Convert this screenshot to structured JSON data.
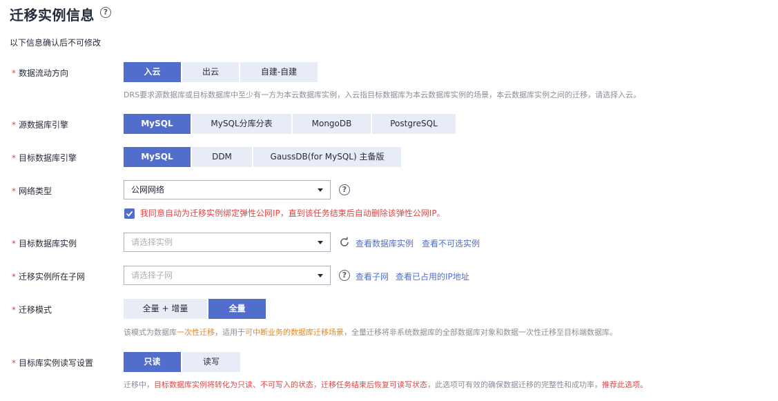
{
  "header": {
    "title": "迁移实例信息",
    "help_glyph": "?",
    "subtitle": "以下信息确认后不可修改"
  },
  "required_mark": "*",
  "direction": {
    "label": "数据流动方向",
    "options": [
      "入云",
      "出云",
      "自建-自建"
    ],
    "selected": "入云",
    "hint": "DRS要求源数据库或目标数据库中至少有一方为本云数据库实例，入云指目标数据库为本云数据库实例的场景，本云数据库实例之间的迁移，请选择入云。"
  },
  "source_engine": {
    "label": "源数据库引擎",
    "options": [
      "MySQL",
      "MySQL分库分表",
      "MongoDB",
      "PostgreSQL"
    ],
    "selected": "MySQL"
  },
  "target_engine": {
    "label": "目标数据库引擎",
    "options": [
      "MySQL",
      "DDM",
      "GaussDB(for MySQL) 主备版"
    ],
    "selected": "MySQL"
  },
  "network": {
    "label": "网络类型",
    "value": "公网网络",
    "help_glyph": "?",
    "checkbox_checked": true,
    "checkbox_text": "我同意自动为迁移实例绑定弹性公网IP，直到该任务结束后自动删除该弹性公网IP。"
  },
  "target_instance": {
    "label": "目标数据库实例",
    "placeholder": "请选择实例",
    "link_view": "查看数据库实例",
    "link_unselectable": "查看不可选实例"
  },
  "subnet": {
    "label": "迁移实例所在子网",
    "placeholder": "请选择子网",
    "help_glyph": "?",
    "link_view": "查看子网",
    "link_ip": "查看已占用的IP地址"
  },
  "mode": {
    "label": "迁移模式",
    "options": [
      "全量 + 增量",
      "全量"
    ],
    "selected": "全量",
    "hint_parts": [
      "该模式为数据库",
      "一次性迁移",
      "，适用于",
      "可中断业务的数据库迁移场景",
      "，全量迁移将非系统数据库的全部数据库对象和数据一次性迁移至目标端数据库。"
    ]
  },
  "readwrite": {
    "label": "目标库实例读写设置",
    "options": [
      "只读",
      "读写"
    ],
    "selected": "只读",
    "hint_parts": [
      "迁移中，",
      "目标数据库实例将转化为只读、不可写入的状态",
      "，",
      "迁移任务结束后恢复可读写状态",
      "，此选项可有效的确保数据迁移的完整性和成功率，",
      "推荐此选项。"
    ]
  },
  "colors": {
    "accent": "#526ecc",
    "inactive_segment": "#e8ecf6",
    "required": "#e54545",
    "warning": "#e54545",
    "highlight": "#e28a28",
    "hint": "#8a8e99"
  }
}
